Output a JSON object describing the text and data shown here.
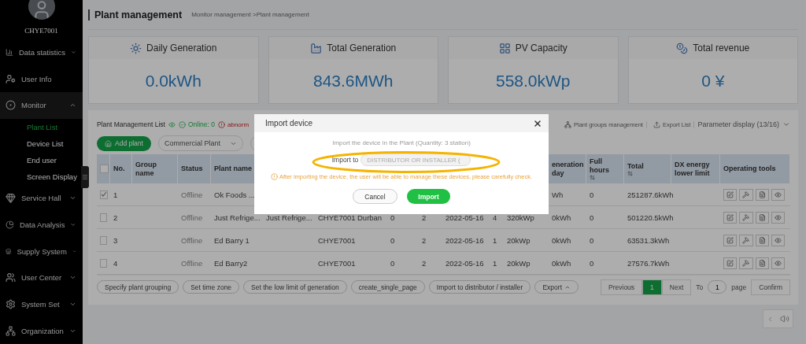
{
  "sidebar": {
    "user": "CHYE7001",
    "items": [
      {
        "label": "Data statistics",
        "has_submenu": true,
        "expanded": false
      },
      {
        "label": "User Info",
        "has_submenu": false,
        "expanded": false
      },
      {
        "label": "Monitor",
        "has_submenu": true,
        "expanded": true,
        "children": [
          {
            "label": "Plant List",
            "selected": true
          },
          {
            "label": "Device List",
            "selected": false
          },
          {
            "label": "End user",
            "selected": false
          },
          {
            "label": "Screen Display",
            "selected": false
          }
        ]
      },
      {
        "label": "Service Hall",
        "has_submenu": true,
        "expanded": false
      },
      {
        "label": "Data Analysis",
        "has_submenu": true,
        "expanded": false
      },
      {
        "label": "Supply System",
        "has_submenu": true,
        "expanded": false
      },
      {
        "label": "User Center",
        "has_submenu": true,
        "expanded": false
      },
      {
        "label": "System Set",
        "has_submenu": true,
        "expanded": false
      },
      {
        "label": "Organization",
        "has_submenu": true,
        "expanded": false
      }
    ]
  },
  "header": {
    "title": "Plant management",
    "breadcrumb": "Monitor management >Plant management"
  },
  "stats": [
    {
      "title": "Daily Generation",
      "value": "0.0kWh"
    },
    {
      "title": "Total Generation",
      "value": "843.6MWh"
    },
    {
      "title": "PV Capacity",
      "value": "558.0kWp"
    },
    {
      "title": "Total revenue",
      "value": "0 ¥"
    }
  ],
  "list": {
    "title": "Plant Management List",
    "online": "Online: 0",
    "abnormal": "abnorm",
    "actions": [
      "Plant groups management",
      "Export List"
    ],
    "parameter_display": "Parameter display",
    "parameter_count": "(13/16)",
    "add_button": "Add plant",
    "filter": "Commercial Plant"
  },
  "table": {
    "all_checked": false,
    "columns": [
      {
        "label": "No.",
        "sortable": false
      },
      {
        "label": "Group name",
        "sortable": false
      },
      {
        "label": "Status",
        "sortable": false
      },
      {
        "label": "Plant name",
        "sortable": false
      },
      {},
      {},
      {},
      {},
      {},
      {},
      {},
      {},
      {
        "label": "eneration day",
        "sortable": false
      },
      {
        "label": "Full hours",
        "sortable": true
      },
      {
        "label": "Total",
        "sortable": true
      },
      {
        "label": "DX energy lower limit",
        "sortable": false
      },
      {
        "label": "Operating tools",
        "sortable": false
      }
    ],
    "rows": [
      {
        "checked": true,
        "cells": [
          "1",
          null,
          "Offline",
          "Ok Foods ...",
          null,
          null,
          null,
          null,
          null,
          null,
          null,
          null,
          "Wh",
          "0",
          "251287.6kWh",
          null,
          null
        ]
      },
      {
        "checked": false,
        "cells": [
          "2",
          null,
          "Offline",
          "Just Refrige...",
          "Just Refrige...",
          "CHYE7001",
          "Durban",
          "0",
          "2",
          "2022-05-16",
          "4",
          "320kWp",
          "0kWh",
          "0",
          "501220.5kWh",
          null,
          null
        ]
      },
      {
        "checked": false,
        "cells": [
          "3",
          null,
          "Offline",
          "Ed Barry 1",
          null,
          "CHYE7001",
          null,
          "0",
          "2",
          "2022-05-16",
          "1",
          "20kWp",
          "0kWh",
          "0",
          "63531.3kWh",
          null,
          null
        ]
      },
      {
        "checked": false,
        "cells": [
          "4",
          null,
          "Offline",
          "Ed Barry2",
          null,
          "CHYE7001",
          null,
          "0",
          "2",
          "2022-05-16",
          "1",
          "20kWp",
          "0kWh",
          "0",
          "27576.7kWh",
          null,
          null
        ]
      }
    ]
  },
  "footer_buttons": [
    "Specify plant grouping",
    "Set time zone",
    "Set the low limit of generation",
    "create_single_page",
    "Import to distributor / installer"
  ],
  "export": "Export",
  "pagination": {
    "previous": "Previous",
    "pages": [
      {
        "label": "1",
        "selected": true
      }
    ],
    "next": "Next",
    "to": "To",
    "page_input": "1",
    "page": "page",
    "confirm": "Confirm"
  },
  "dialog": {
    "title": "Import device",
    "info": "Import the device in the Plant (Quantity: 3 station)",
    "import_label": "Import to",
    "placeholder": "DISTRIBUTOR OR INSTALLER (",
    "warning": "After importing the device, the user will be able to manage these devices, please carefully check.",
    "cancel": "Cancel",
    "confirm": "Import"
  }
}
